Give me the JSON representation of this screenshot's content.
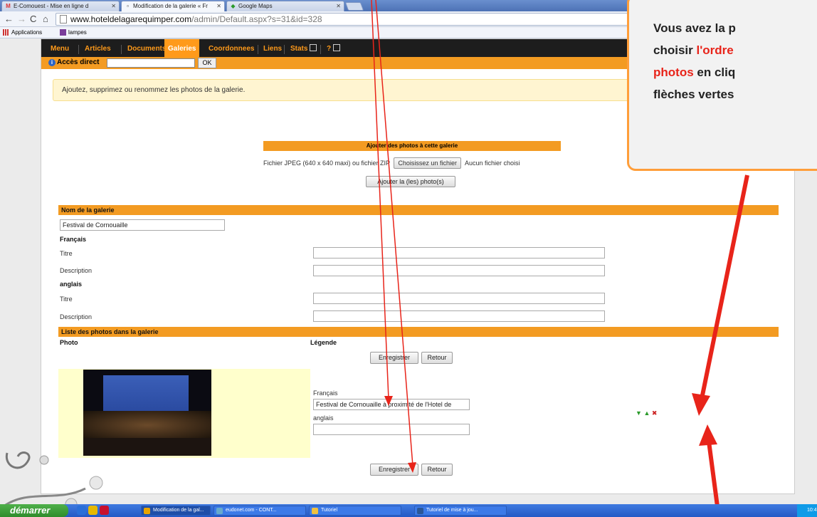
{
  "browser": {
    "tabs": [
      {
        "label": "E-Comouest - Mise en ligne d",
        "icon": "gmail-icon",
        "active": false
      },
      {
        "label": "Modification de la galerie « Fr",
        "icon": "page-icon",
        "active": true
      },
      {
        "label": "Google Maps",
        "icon": "maps-icon",
        "active": false
      }
    ],
    "url_host": "www.hoteldelagarequimper.com",
    "url_path": "/admin/Default.aspx?s=31&id=328",
    "bookmarks": [
      "Applications",
      "lampes"
    ]
  },
  "site": {
    "menu": [
      "Menu",
      "Articles",
      "Documents",
      "Galeries",
      "Coordonnees",
      "Liens",
      "Stats",
      "?"
    ],
    "active_menu": "Galeries",
    "acces_label": "Accès direct",
    "ok_label": "OK",
    "notice": "Ajoutez, supprimez ou renommez les photos de la galerie.",
    "add_header": "Ajouter des photos à cette galerie",
    "file_label": "Fichier JPEG (640 x 640 maxi) ou fichier ZIP",
    "choose_button": "Choisissez un fichier",
    "no_file": "Aucun fichier choisi",
    "add_button": "Ajouter la (les) photo(s)",
    "gallery_name_header": "Nom de la galerie",
    "gallery_name": "Festival de Cornouaille",
    "lang_fr": "Français",
    "lang_en": "anglais",
    "title_label": "Titre",
    "description_label": "Description",
    "photos_header": "Liste des photos dans la galerie",
    "col_photo": "Photo",
    "col_legend": "Légende",
    "save_button": "Enregistrer",
    "back_button": "Retour",
    "legend_fr_label": "Français",
    "legend_fr_value": "Festival de Cornouaille à proximité de l'Hotel de",
    "legend_en_label": "anglais",
    "legend_en_value": ""
  },
  "callout": {
    "line1": "Vous avez la p",
    "line2_a": "choisir ",
    "line2_b": "l'ordre",
    "line3_a": "photos",
    "line3_b": " en cliq",
    "line4": "flèches vertes"
  },
  "taskbar": {
    "start": "démarrer",
    "tasks": [
      "Modification de la gal...",
      "eudonet.com - CONT...",
      "Tutoriel",
      "Tutoriel de mise à jou..."
    ],
    "clock": "10:4"
  },
  "colors": {
    "accent": "#f39b22",
    "menu_bg": "#1d1d1d",
    "annotation_red": "#e8241a"
  }
}
